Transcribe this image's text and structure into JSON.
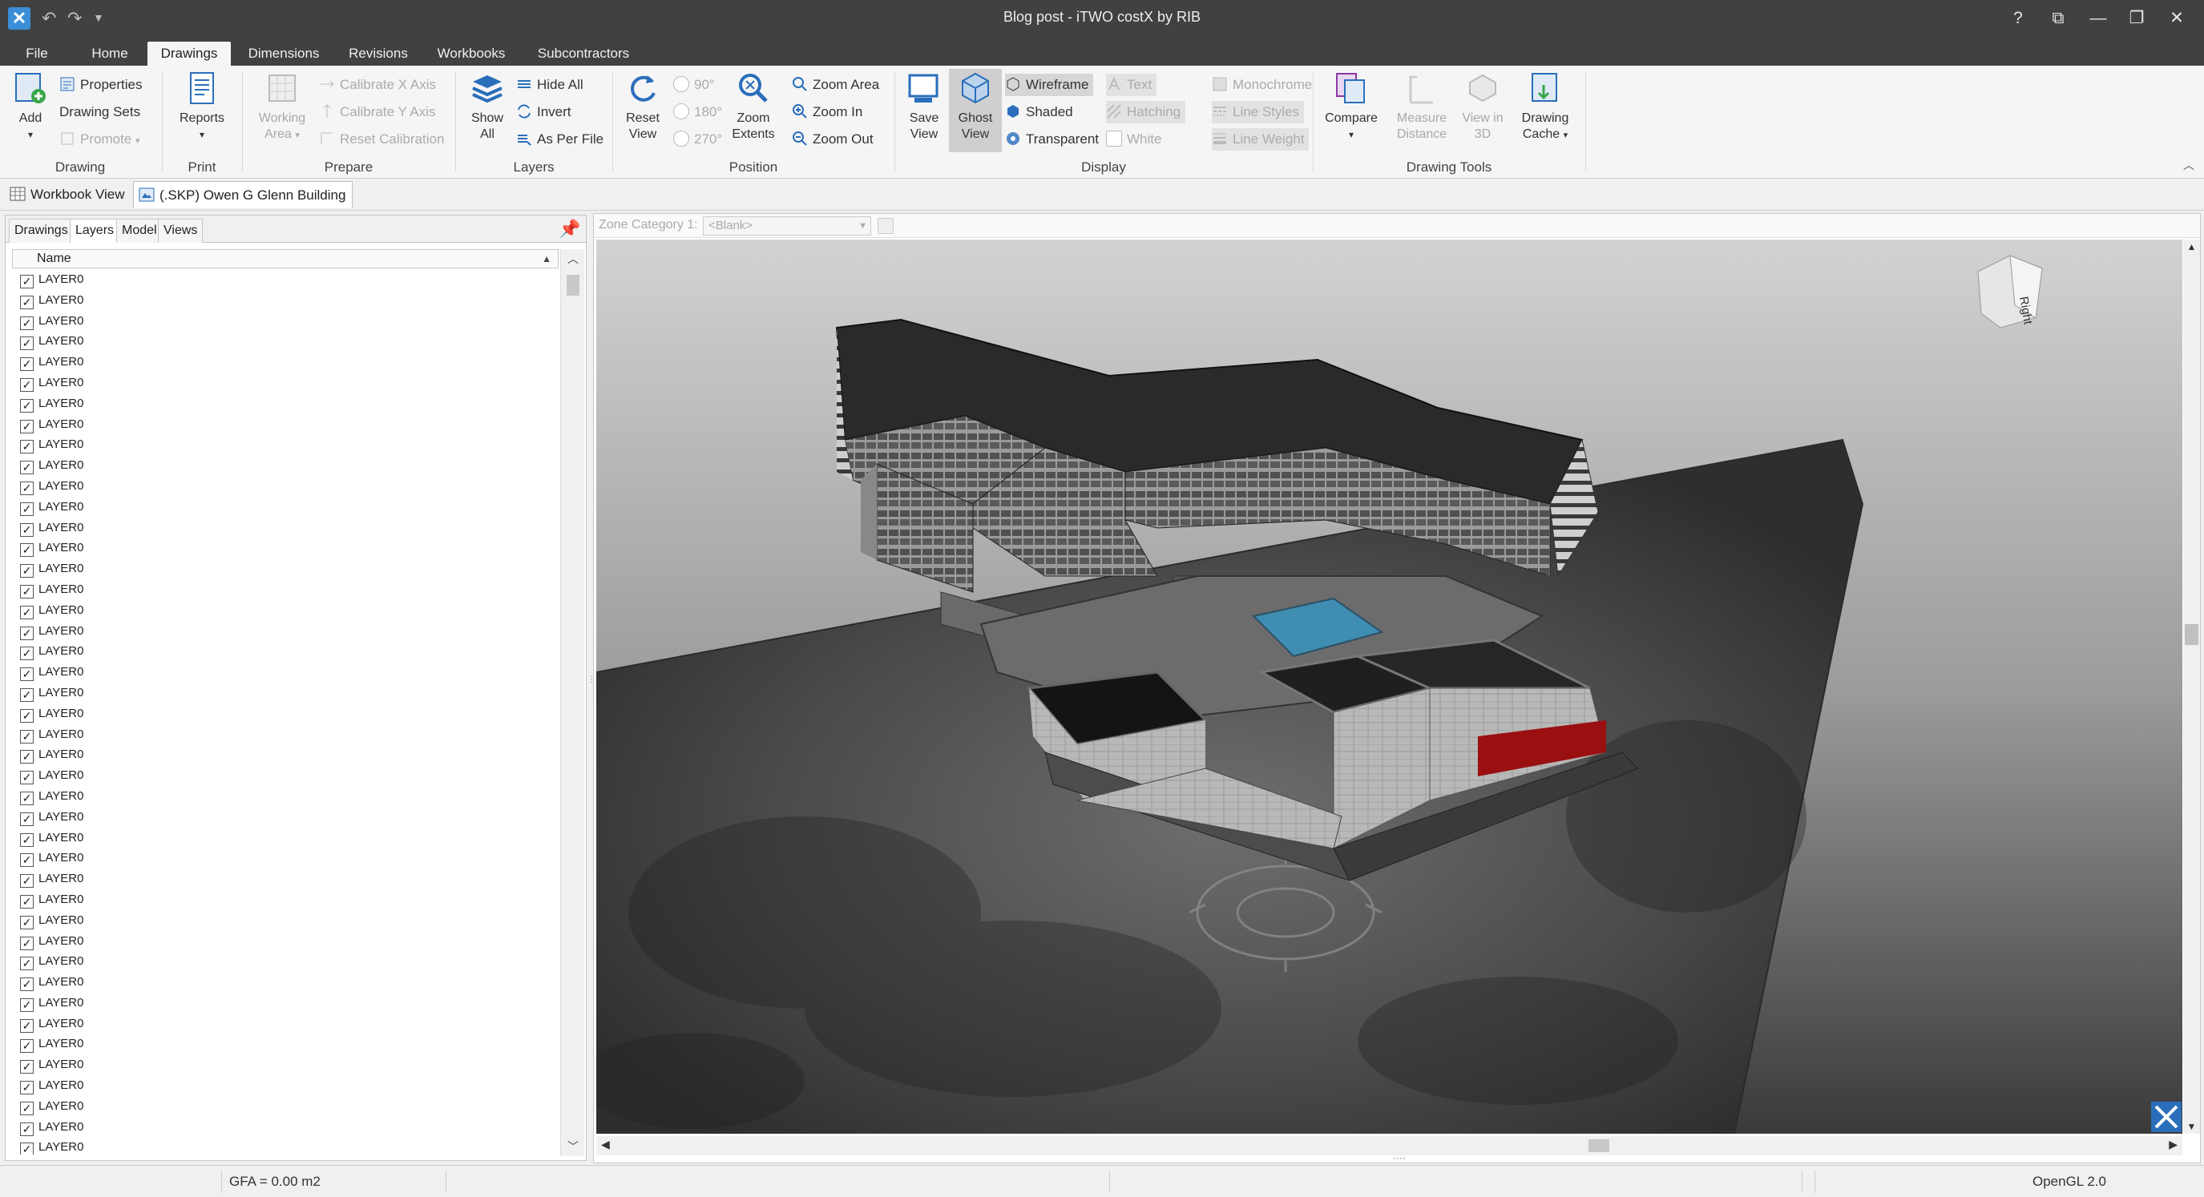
{
  "window": {
    "title": "Blog post - iTWO costX by RIB",
    "controls": [
      "?",
      "⧉",
      "—",
      "❐",
      "✕"
    ]
  },
  "ribbon_tabs": [
    {
      "label": "File"
    },
    {
      "label": "Home"
    },
    {
      "label": "Drawings",
      "active": true
    },
    {
      "label": "Dimensions"
    },
    {
      "label": "Revisions"
    },
    {
      "label": "Workbooks"
    },
    {
      "label": "Subcontractors"
    }
  ],
  "ribbon": {
    "drawing": {
      "group_label": "Drawing",
      "add": "Add",
      "properties": "Properties",
      "drawing_sets": "Drawing Sets",
      "promote": "Promote"
    },
    "print": {
      "group_label": "Print",
      "reports": "Reports"
    },
    "prepare": {
      "group_label": "Prepare",
      "working_area": "Working Area",
      "calibrate_x": "Calibrate X Axis",
      "calibrate_y": "Calibrate Y Axis",
      "reset_calibration": "Reset Calibration"
    },
    "layers": {
      "group_label": "Layers",
      "show_all": "Show All",
      "hide_all": "Hide All",
      "invert": "Invert",
      "as_per_file": "As Per File"
    },
    "position": {
      "group_label": "Position",
      "reset_view": "Reset View",
      "rot_90": "90°",
      "rot_180": "180°",
      "rot_270": "270°",
      "zoom_extents": "Zoom Extents",
      "zoom_area": "Zoom Area",
      "zoom_in": "Zoom In",
      "zoom_out": "Zoom Out"
    },
    "display": {
      "group_label": "Display",
      "save_view": "Save View",
      "ghost_view": "Ghost View",
      "wireframe": "Wireframe",
      "shaded": "Shaded",
      "transparent": "Transparent",
      "text": "Text",
      "hatching": "Hatching",
      "white": "White",
      "monochrome": "Monochrome",
      "line_styles": "Line Styles",
      "line_weight": "Line Weight"
    },
    "drawing_tools": {
      "group_label": "Drawing Tools",
      "compare": "Compare",
      "measure_distance": "Measure Distance",
      "view_in_3d": "View in 3D",
      "drawing_cache": "Drawing Cache"
    }
  },
  "doc_tabs": [
    {
      "label": "Workbook View"
    },
    {
      "label": "(.SKP) Owen G Glenn Building",
      "active": true
    }
  ],
  "left_panel": {
    "tabs": [
      {
        "label": "Drawings"
      },
      {
        "label": "Layers",
        "active": true
      },
      {
        "label": "Model"
      },
      {
        "label": "Views"
      }
    ],
    "column_header": "Name",
    "layers": [
      "LAYER0",
      "LAYER0",
      "LAYER0",
      "LAYER0",
      "LAYER0",
      "LAYER0",
      "LAYER0",
      "LAYER0",
      "LAYER0",
      "LAYER0",
      "LAYER0",
      "LAYER0",
      "LAYER0",
      "LAYER0",
      "LAYER0",
      "LAYER0",
      "LAYER0",
      "LAYER0",
      "LAYER0",
      "LAYER0",
      "LAYER0",
      "LAYER0",
      "LAYER0",
      "LAYER0",
      "LAYER0",
      "LAYER0",
      "LAYER0",
      "LAYER0",
      "LAYER0",
      "LAYER0",
      "LAYER0",
      "LAYER0",
      "LAYER0",
      "LAYER0",
      "LAYER0",
      "LAYER0",
      "LAYER0",
      "LAYER0",
      "LAYER0",
      "LAYER0",
      "LAYER0",
      "LAYER0",
      "LAYER0"
    ]
  },
  "viewer": {
    "zone_label": "Zone Category 1:",
    "zone_value": "<Blank>",
    "view_cube_face": "Right"
  },
  "status": {
    "gfa": "GFA = 0.00 m2",
    "renderer": "OpenGL 2.0"
  },
  "colors": {
    "titlebar": "#414141",
    "accent": "#2a6ebb",
    "pool": "#3f8db0",
    "red_panels": "#9a1010"
  }
}
